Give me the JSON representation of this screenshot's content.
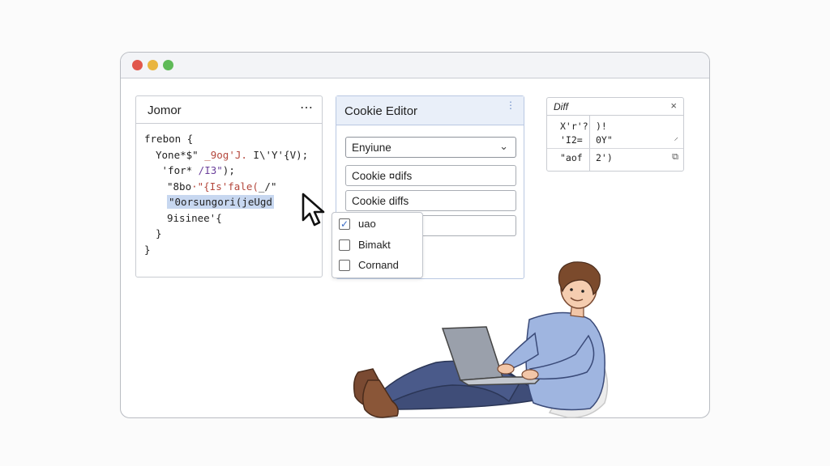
{
  "editor": {
    "title": "Jomor",
    "menu_icon": "⋯",
    "lines": [
      {
        "indent": 0,
        "parts": [
          {
            "t": "frebon {",
            "c": "c-dark"
          }
        ]
      },
      {
        "indent": 1,
        "parts": [
          {
            "t": "Yone*$\" ",
            "c": "c-dark"
          },
          {
            "t": "_9og'J.",
            "c": "c-red"
          },
          {
            "t": " I\\'Y'{V);",
            "c": "c-dark"
          }
        ]
      },
      {
        "indent": 1,
        "parts": [
          {
            "t": " 'for*",
            "c": "c-dark"
          },
          {
            "t": " /I3\"",
            "c": "c-purple"
          },
          {
            "t": ");",
            "c": "c-dark"
          }
        ]
      },
      {
        "indent": 2,
        "parts": [
          {
            "t": "\"8bo",
            "c": "c-dark"
          },
          {
            "t": "·\"{Is'fale(",
            "c": "c-red"
          },
          {
            "t": "_/\"",
            "c": "c-dark"
          }
        ]
      },
      {
        "indent": 2,
        "highlight": true,
        "parts": [
          {
            "t": "\"0orsungori(jeUgd",
            "c": "c-dark"
          }
        ]
      },
      {
        "indent": 2,
        "parts": [
          {
            "t": "9isinee'{",
            "c": "c-dark"
          }
        ]
      },
      {
        "indent": 1,
        "parts": [
          {
            "t": "}",
            "c": "c-dark"
          }
        ]
      },
      {
        "indent": 0,
        "parts": [
          {
            "t": "}",
            "c": "c-dark"
          }
        ]
      }
    ]
  },
  "cookie_editor": {
    "title": "Cookie Editor",
    "menu_icon": "⋮",
    "select_value": "Enyiune",
    "field1": "Cookie ¤difs",
    "field2": "Cookie diffs",
    "field3": ""
  },
  "dropdown": {
    "items": [
      {
        "label": "uao",
        "checked": true
      },
      {
        "label": "Bimakt",
        "checked": false
      },
      {
        "label": "Cornand",
        "checked": false
      }
    ]
  },
  "diff": {
    "title": "Diff",
    "close_icon": "×",
    "rows": [
      {
        "left": "X'r'?",
        "right": ")!"
      },
      {
        "left": "'I2=",
        "right": "0Y\""
      },
      {
        "left": "\"aof",
        "right": "2')"
      }
    ]
  },
  "icons": [
    "dot-red",
    "dot-yellow",
    "dot-green",
    "more-icon",
    "chevron-down-icon",
    "checkbox-icon",
    "close-icon",
    "copy-icon",
    "mouse-cursor-icon"
  ],
  "colors": {
    "accent": "#3a6bc4",
    "highlight": "#c7d7f0",
    "cookie_header": "#e9eff9"
  }
}
